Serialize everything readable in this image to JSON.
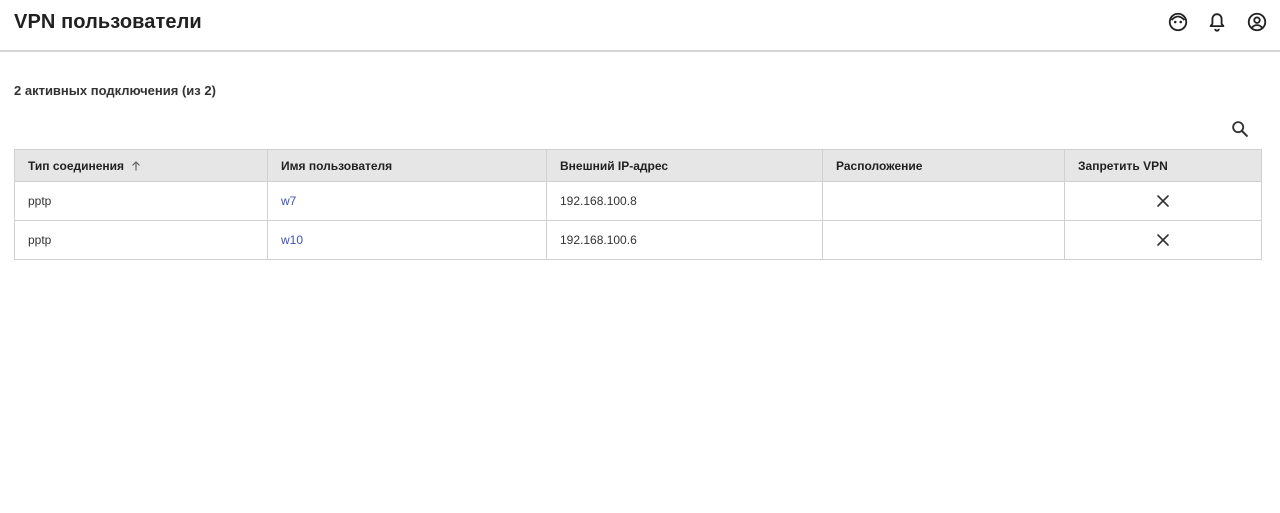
{
  "header": {
    "title": "VPN пользователи",
    "icons": [
      "support-icon",
      "bell-icon",
      "account-circle-icon"
    ]
  },
  "summary": "2 активных подключения (из 2)",
  "table": {
    "columns": [
      "Тип соединения",
      "Имя пользователя",
      "Внешний IP-адрес",
      "Расположение",
      "Запретить VPN"
    ],
    "sorted_column": "Тип соединения",
    "sort_direction": "asc",
    "rows": [
      {
        "type": "pptp",
        "user": "w7",
        "ip": "192.168.100.8",
        "location": ""
      },
      {
        "type": "pptp",
        "user": "w10",
        "ip": "192.168.100.6",
        "location": ""
      }
    ]
  },
  "colors": {
    "link": "#3f51b5",
    "header_bg": "#e6e6e6",
    "border": "#d0d0d0"
  }
}
